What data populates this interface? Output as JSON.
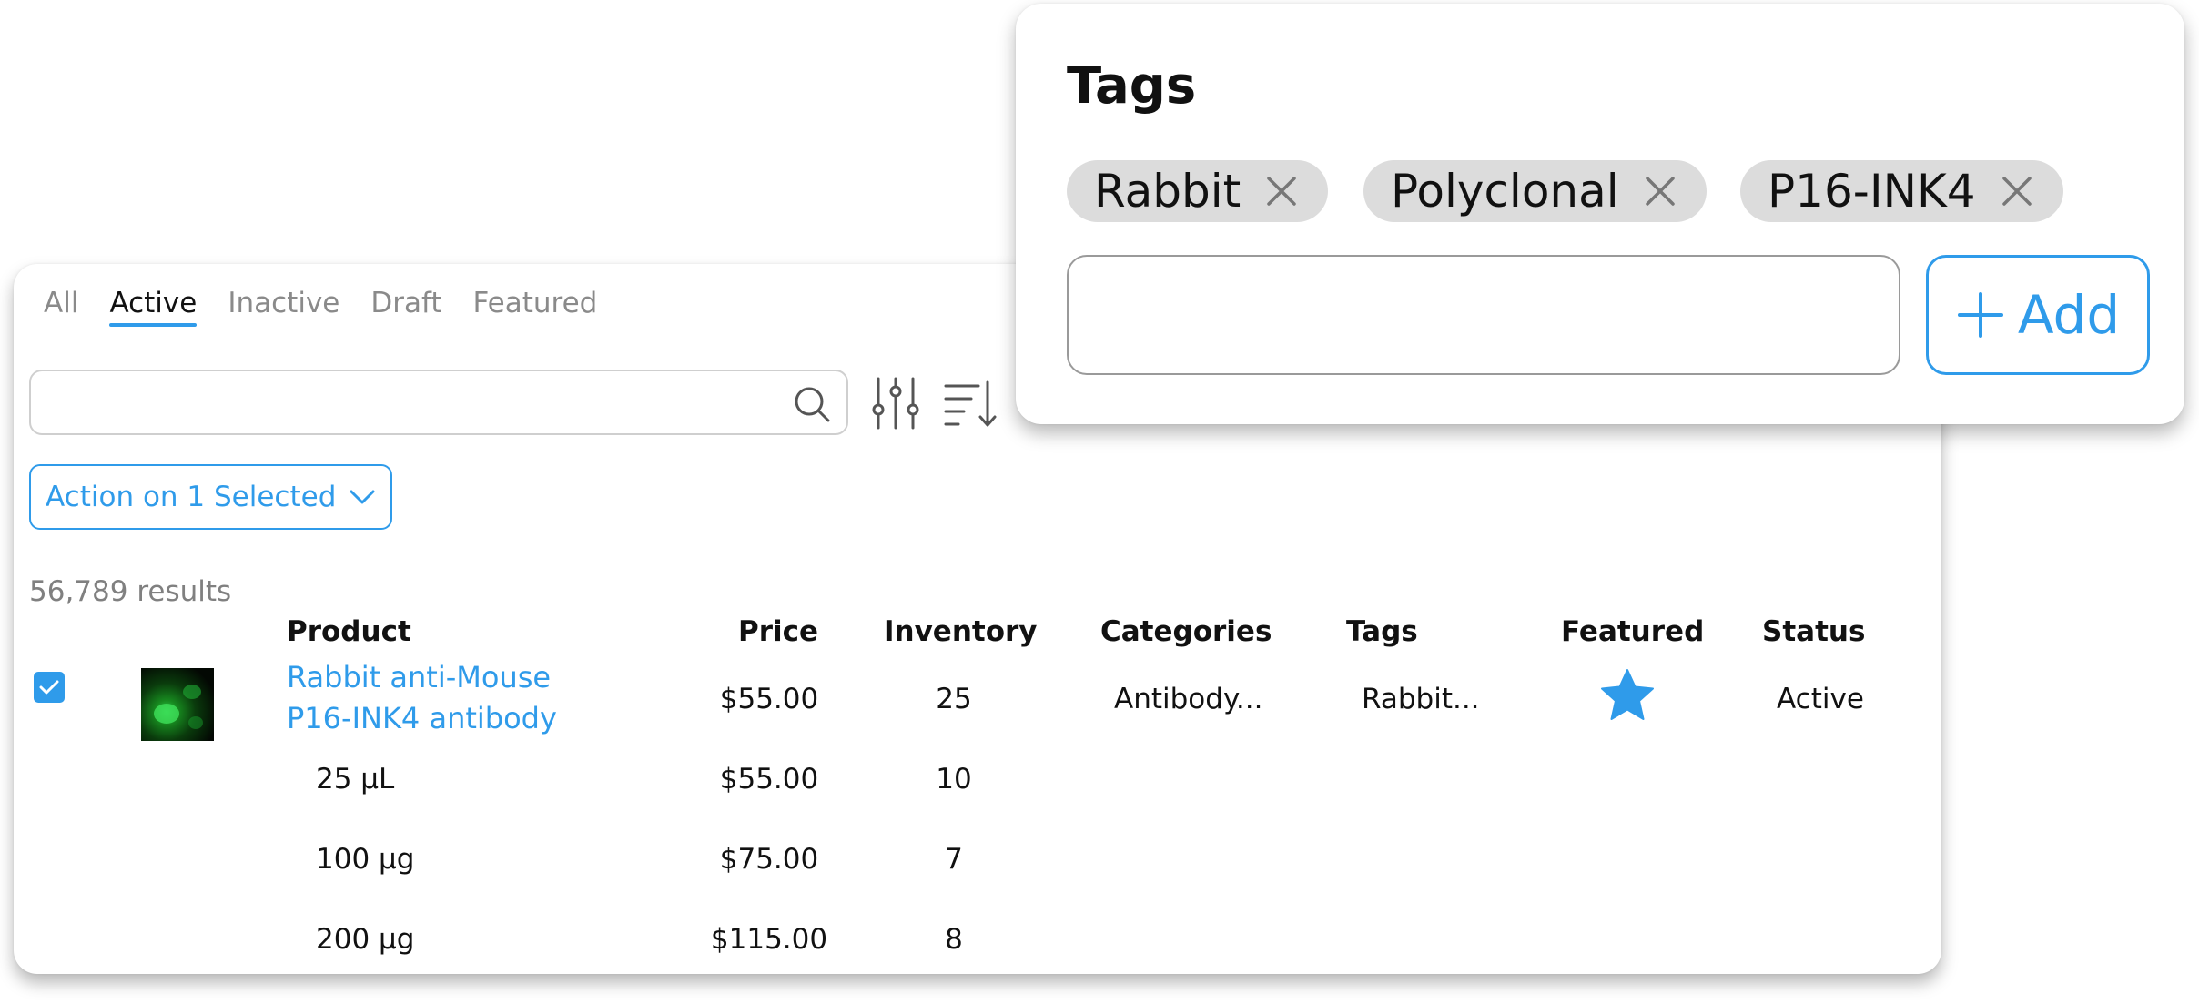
{
  "tabs": [
    "All",
    "Active",
    "Inactive",
    "Draft",
    "Featured"
  ],
  "active_tab": "Active",
  "search": {
    "placeholder": ""
  },
  "bulk_action": {
    "label": "Action on 1 Selected"
  },
  "results_count": "56,789 results",
  "columns": {
    "product": "Product",
    "price": "Price",
    "inventory": "Inventory",
    "categories": "Categories",
    "tags": "Tags",
    "featured": "Featured",
    "status": "Status"
  },
  "product": {
    "name_line1": "Rabbit anti-Mouse",
    "name_line2": "P16-INK4 antibody",
    "price": "$55.00",
    "inventory": "25",
    "categories": "Antibody...",
    "tags": "Rabbit...",
    "featured": true,
    "status": "Active",
    "selected": true
  },
  "variants": [
    {
      "name": "25 µL",
      "price": "$55.00",
      "inventory": "10"
    },
    {
      "name": "100 µg",
      "price": "$75.00",
      "inventory": "7"
    },
    {
      "name": "200 µg",
      "price": "$115.00",
      "inventory": "8"
    }
  ],
  "tags_panel": {
    "title": "Tags",
    "tags": [
      "Rabbit",
      "Polyclonal",
      "P16-INK4"
    ],
    "input_value": "",
    "add_label": "Add"
  },
  "colors": {
    "accent": "#2f9bea",
    "chip_bg": "#dcdcdc",
    "muted_text": "#8a8a8a"
  },
  "icons": {
    "search": "search-icon",
    "filter": "sliders-icon",
    "sort": "sort-icon",
    "dropdown": "chevron-down-icon",
    "checkbox": "checkmark-icon",
    "featured": "star-icon",
    "remove_tag": "close-icon",
    "add": "plus-icon"
  }
}
